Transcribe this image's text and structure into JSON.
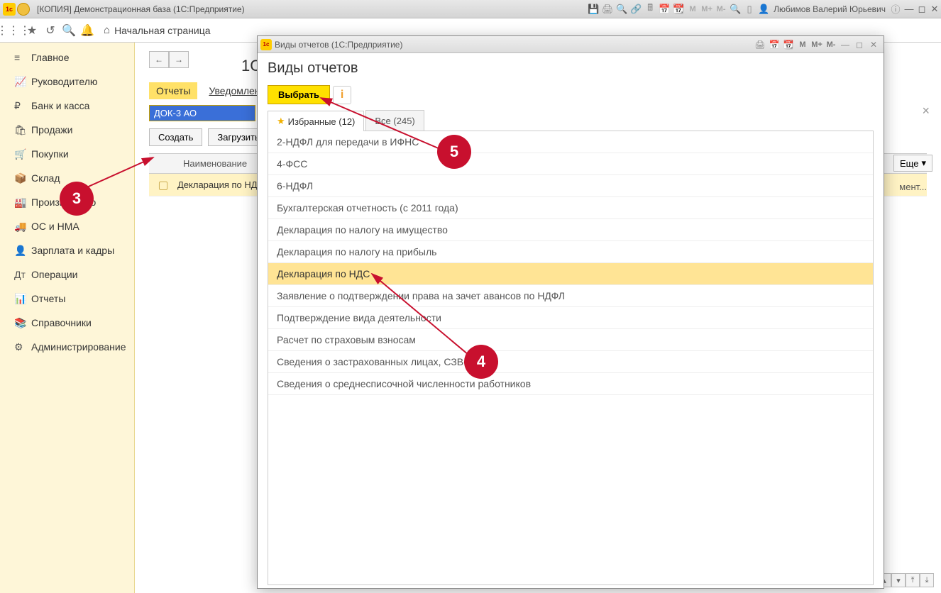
{
  "titlebar": {
    "app_title": "[КОПИЯ] Демонстрационная база  (1С:Предприятие)",
    "user_name": "Любимов Валерий Юрьевич",
    "m_labels": [
      "M",
      "M+",
      "M-"
    ]
  },
  "toolbar2": {
    "home_label": "Начальная страница"
  },
  "leftnav": {
    "items": [
      {
        "icon": "≡",
        "label": "Главное"
      },
      {
        "icon": "📈",
        "label": "Руководителю"
      },
      {
        "icon": "₽",
        "label": "Банк и касса"
      },
      {
        "icon": "🛍",
        "label": "Продажи"
      },
      {
        "icon": "🛒",
        "label": "Покупки"
      },
      {
        "icon": "📦",
        "label": "Склад"
      },
      {
        "icon": "🏭",
        "label": "Производство"
      },
      {
        "icon": "🚚",
        "label": "ОС и НМА"
      },
      {
        "icon": "👤",
        "label": "Зарплата и кадры"
      },
      {
        "icon": "Дт",
        "label": "Операции"
      },
      {
        "icon": "📊",
        "label": "Отчеты"
      },
      {
        "icon": "📚",
        "label": "Справочники"
      },
      {
        "icon": "⚙",
        "label": "Администрирование"
      }
    ]
  },
  "main": {
    "page_title_partial": "1С",
    "tabs": {
      "reports": "Отчеты",
      "notifications": "Уведомления"
    },
    "filter_value": "ДОК-3 АО",
    "buttons": {
      "create": "Создать",
      "load": "Загрузить",
      "more": "Еще"
    },
    "columns": {
      "name": "Наименование",
      "comment_partial": "мент..."
    },
    "rows": [
      {
        "label": "Декларация по НД"
      }
    ]
  },
  "modal": {
    "window_title": "Виды отчетов  (1С:Предприятие)",
    "heading": "Виды отчетов",
    "select_btn": "Выбрать",
    "tabs": {
      "favorites": "Избранные (12)",
      "all": "Все (245)"
    },
    "reports": [
      "2-НДФЛ для передачи в ИФНС",
      "4-ФСС",
      "6-НДФЛ",
      "Бухгалтерская отчетность (с 2011 года)",
      "Декларация по налогу на имущество",
      "Декларация по налогу на прибыль",
      "Декларация по НДС",
      "Заявление о подтверждении права на зачет авансов по НДФЛ",
      "Подтверждение вида деятельности",
      "Расчет по страховым взносам",
      "Сведения о застрахованных лицах, СЗВ-М",
      "Сведения о среднесписочной численности работников"
    ],
    "selected_index": 6,
    "m_labels": [
      "M",
      "M+",
      "M-"
    ]
  },
  "annotations": {
    "n3": "3",
    "n4": "4",
    "n5": "5"
  }
}
